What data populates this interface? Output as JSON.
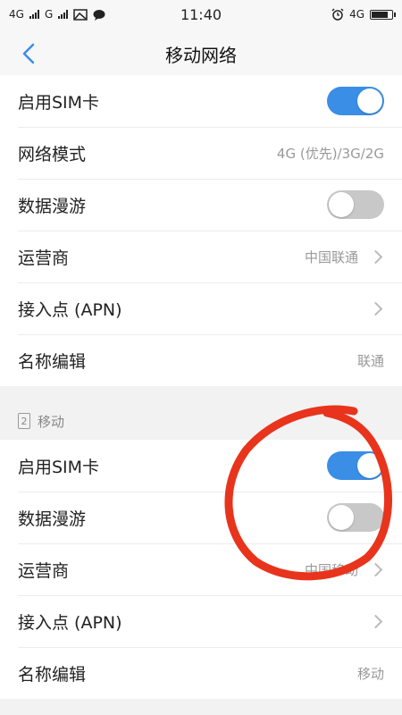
{
  "status_bar": {
    "left_network_1": "4G",
    "left_network_2": "G",
    "time": "11:40",
    "right_network": "4G"
  },
  "nav": {
    "title": "移动网络"
  },
  "sim1": {
    "rows": [
      {
        "label": "启用SIM卡",
        "toggle": "on"
      },
      {
        "label": "网络模式",
        "value": "4G (优先)/3G/2G"
      },
      {
        "label": "数据漫游",
        "toggle": "off"
      },
      {
        "label": "运营商",
        "value": "中国联通"
      },
      {
        "label": "接入点 (APN)"
      },
      {
        "label": "名称编辑",
        "value": "联通"
      }
    ]
  },
  "sim2": {
    "header": "移动",
    "slot_number": "2",
    "rows": [
      {
        "label": "启用SIM卡",
        "toggle": "on"
      },
      {
        "label": "数据漫游",
        "toggle": "off"
      },
      {
        "label": "运营商",
        "value": "中国移动"
      },
      {
        "label": "接入点 (APN)"
      },
      {
        "label": "名称编辑",
        "value": "移动"
      }
    ]
  },
  "colors": {
    "accent": "#3a8ee6",
    "annotation": "#e8341c"
  }
}
